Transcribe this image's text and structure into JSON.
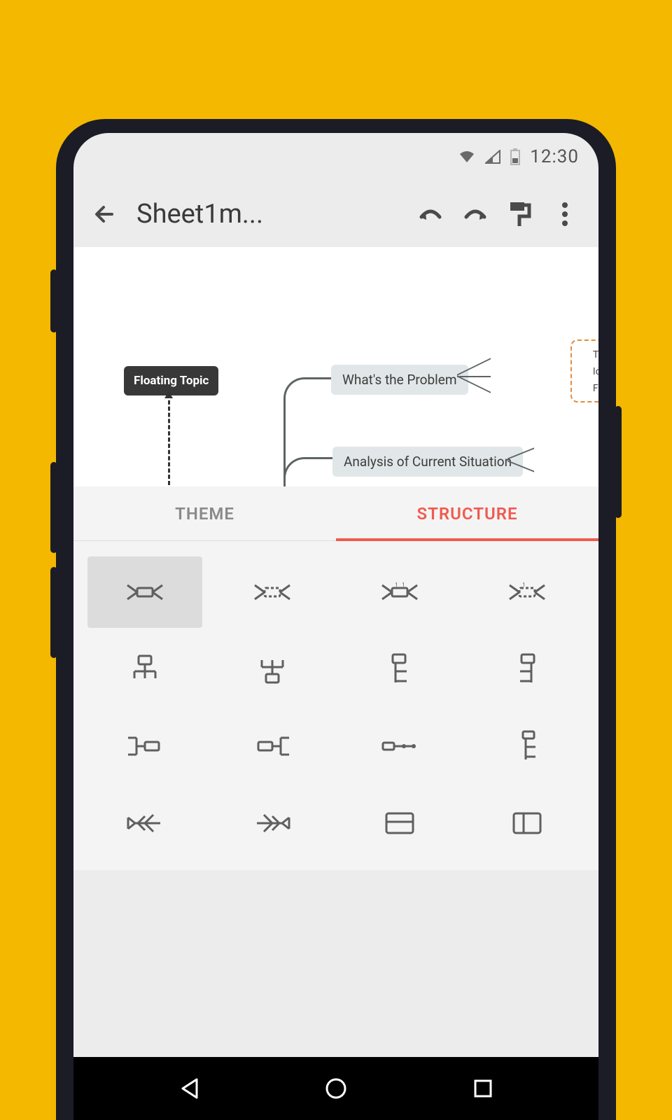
{
  "status": {
    "time": "12:30"
  },
  "appbar": {
    "title": "Sheet1m...",
    "actions": {
      "undo": "undo-icon",
      "redo": "redo-icon",
      "format": "format-paint-icon",
      "more": "more-vert-icon"
    }
  },
  "canvas": {
    "floating_topic": "Floating Topic",
    "problem": "What's the Problem",
    "analysis": "Analysis of Current Situation",
    "sub1": "Th",
    "sub2": "Id",
    "sub3": "Fi"
  },
  "tabs": {
    "theme": "THEME",
    "structure": "STRUCTURE",
    "active": "structure"
  },
  "structures": [
    {
      "id": "map-balanced",
      "selected": true
    },
    {
      "id": "map-clockwise",
      "selected": false
    },
    {
      "id": "map-anticlockwise",
      "selected": false
    },
    {
      "id": "map-free",
      "selected": false
    },
    {
      "id": "org-down",
      "selected": false
    },
    {
      "id": "org-up",
      "selected": false
    },
    {
      "id": "tree-right-down",
      "selected": false
    },
    {
      "id": "tree-left-down",
      "selected": false
    },
    {
      "id": "logic-right",
      "selected": false
    },
    {
      "id": "logic-left",
      "selected": false
    },
    {
      "id": "timeline-horizontal",
      "selected": false
    },
    {
      "id": "timeline-vertical",
      "selected": false
    },
    {
      "id": "fishbone-left",
      "selected": false
    },
    {
      "id": "fishbone-right",
      "selected": false
    },
    {
      "id": "matrix-row",
      "selected": false
    },
    {
      "id": "matrix-column",
      "selected": false
    }
  ]
}
